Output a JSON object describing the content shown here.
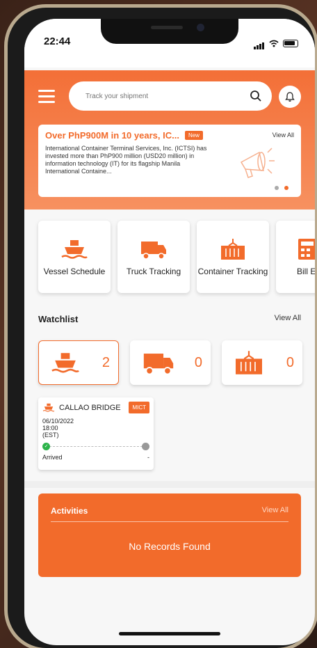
{
  "status_bar": {
    "time": "22:44"
  },
  "search": {
    "placeholder": "Track your shipment"
  },
  "banner": {
    "title": "Over PhP900M in 10 years, IC...",
    "badge": "New",
    "view_all": "View All",
    "body": "International Container Terminal Services, Inc. (ICTSI) has invested more than PhP900 million (USD20 million) in information technology (IT) for its flagship Manila International Containe..."
  },
  "services": [
    {
      "label": "Vessel Schedule",
      "icon": "ship-icon"
    },
    {
      "label": "Truck Tracking",
      "icon": "truck-icon"
    },
    {
      "label": "Container Tracking",
      "icon": "container-icon"
    },
    {
      "label": "Bill Esti",
      "icon": "calculator-icon"
    }
  ],
  "watchlist": {
    "title": "Watchlist",
    "view_all": "View All",
    "counts": {
      "vessel": "2",
      "truck": "0",
      "container": "0"
    }
  },
  "vessel_card": {
    "name": "CALLAO BRIDGE",
    "terminal": "MICT",
    "date": "06/10/2022",
    "time": "18:00",
    "zone": "(EST)",
    "status": "Arrived",
    "end_value": "-"
  },
  "activities": {
    "title": "Activities",
    "view_all": "View All",
    "empty_text": "No Records Found"
  },
  "colors": {
    "accent": "#f26b2b"
  }
}
